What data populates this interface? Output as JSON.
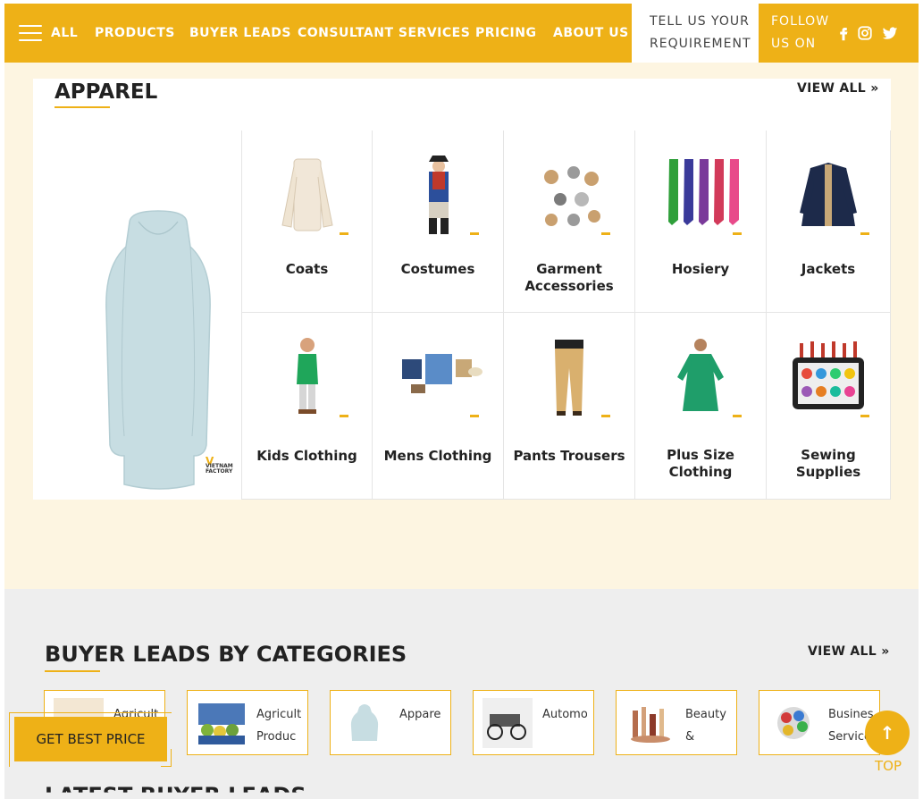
{
  "nav": {
    "items": [
      "ALL",
      "PRODUCTS",
      "BUYER LEADS",
      "CONSULTANT SERVICES",
      "PRICING",
      "ABOUT US"
    ],
    "tell_line1": "TELL US YOUR",
    "tell_line2": "REQUIREMENT",
    "follow_line1": "FOLLOW",
    "follow_line2": "US ON",
    "social": [
      "facebook-icon",
      "instagram-icon",
      "twitter-icon"
    ]
  },
  "apparel": {
    "title": "APPAREL",
    "view_all": "VIEW ALL",
    "hero_badge": "VIETNAM FACTORY",
    "categories": [
      {
        "label": "Coats"
      },
      {
        "label": "Costumes"
      },
      {
        "label": "Garment Accessories"
      },
      {
        "label": "Hosiery"
      },
      {
        "label": "Jackets"
      },
      {
        "label": "Kids Clothing"
      },
      {
        "label": "Mens Clothing"
      },
      {
        "label": "Pants Trousers"
      },
      {
        "label": "Plus Size Clothing"
      },
      {
        "label": "Sewing Supplies"
      }
    ]
  },
  "leads": {
    "title": "BUYER LEADS BY CATEGORIES",
    "view_all": "VIEW ALL",
    "cards": [
      {
        "line1": "Agricult",
        "line2": ""
      },
      {
        "line1": "Agricult",
        "line2": "Produc"
      },
      {
        "line1": "Appare",
        "line2": ""
      },
      {
        "line1": "Automo",
        "line2": ""
      },
      {
        "line1": "Beauty",
        "line2": "&"
      },
      {
        "line1": "Busines",
        "line2": "Service"
      }
    ],
    "next_title": "LATEST BUYER LEADS"
  },
  "get_best_price": "GET BEST PRICE",
  "top_label": "TOP",
  "colors": {
    "accent": "#eeb117",
    "apparel_bg": "#fdf5e1",
    "leads_bg": "#eeeeee"
  }
}
